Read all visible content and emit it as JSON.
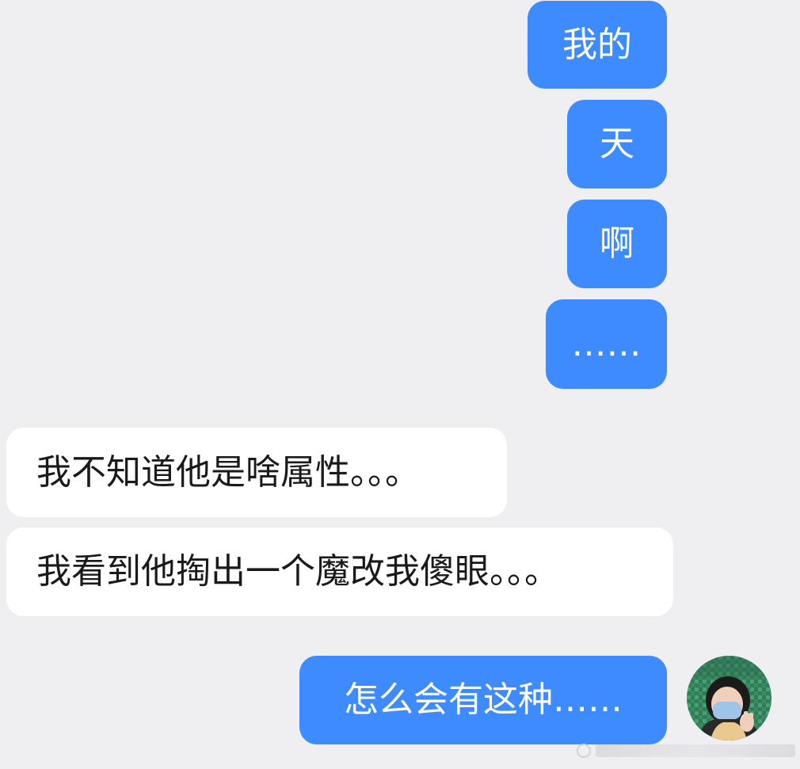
{
  "chat": {
    "messages": [
      {
        "side": "outgoing",
        "text": "我的"
      },
      {
        "side": "outgoing",
        "text": "天"
      },
      {
        "side": "outgoing",
        "text": "啊"
      },
      {
        "side": "outgoing",
        "text": "……"
      },
      {
        "side": "incoming",
        "text": "我不知道他是啥属性。。。"
      },
      {
        "side": "incoming",
        "text": "我看到他掏出一个魔改我傻眼。。。"
      },
      {
        "side": "outgoing",
        "text": "怎么会有这种……"
      }
    ]
  },
  "colors": {
    "background": "#efeff1",
    "outgoing_bubble": "#3e8bff",
    "incoming_bubble": "#ffffff",
    "outgoing_text": "#ffffff",
    "incoming_text": "#1a1a1a"
  },
  "avatar": {
    "icon": "user-avatar-photo"
  },
  "watermark": {
    "icon": "watermark-logo"
  }
}
